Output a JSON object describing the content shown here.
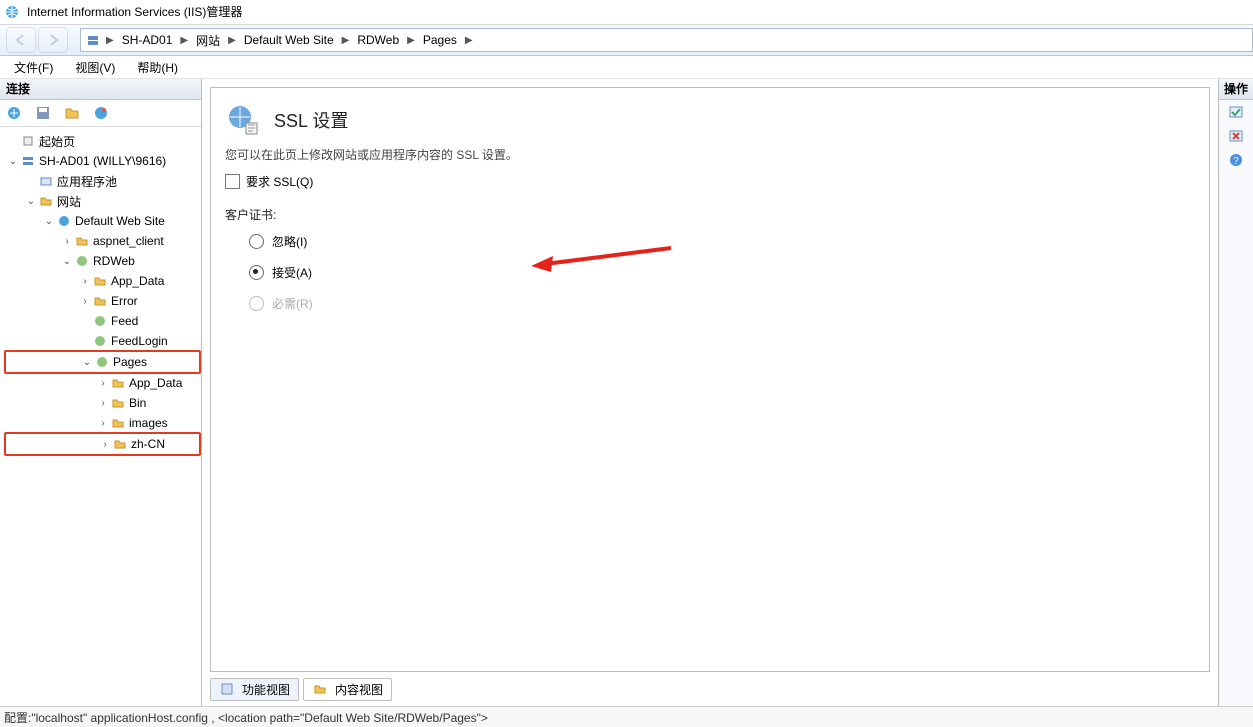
{
  "window": {
    "title": "Internet Information Services (IIS)管理器"
  },
  "breadcrumb": {
    "items": [
      "SH-AD01",
      "网站",
      "Default Web Site",
      "RDWeb",
      "Pages"
    ]
  },
  "menu": {
    "file": "文件(F)",
    "view": "视图(V)",
    "help": "帮助(H)"
  },
  "left": {
    "header": "连接",
    "tree": {
      "start": "起始页",
      "server": "SH-AD01 (WILLY\\9616)",
      "app_pools": "应用程序池",
      "sites": "网站",
      "default_site": "Default Web Site",
      "aspnet_client": "aspnet_client",
      "rdweb": "RDWeb",
      "app_data": "App_Data",
      "error": "Error",
      "feed": "Feed",
      "feedlogin": "FeedLogin",
      "pages": "Pages",
      "pages_app_data": "App_Data",
      "bin": "Bin",
      "images": "images",
      "zh_cn": "zh-CN"
    }
  },
  "center": {
    "title": "SSL 设置",
    "desc": "您可以在此页上修改网站或应用程序内容的 SSL 设置。",
    "require_ssl": "要求 SSL(Q)",
    "client_cert_label": "客户证书:",
    "radio_ignore": "忽略(I)",
    "radio_accept": "接受(A)",
    "radio_require": "必需(R)",
    "tabs": {
      "features": "功能视图",
      "content": "内容视图"
    }
  },
  "right": {
    "header": "操作"
  },
  "status": "配置:\"localhost\" applicationHost.config , <location path=\"Default Web Site/RDWeb/Pages\">"
}
